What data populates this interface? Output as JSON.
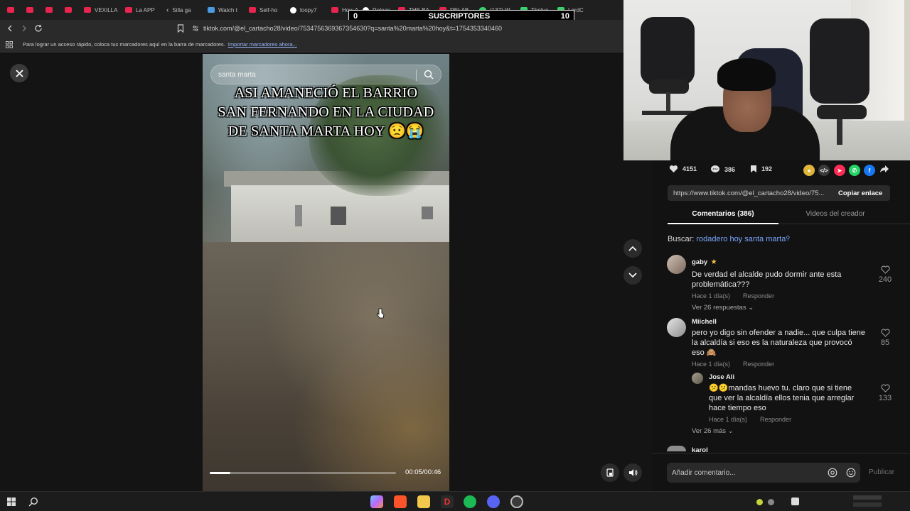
{
  "browser": {
    "tabs": [
      {
        "label": ""
      },
      {
        "label": ""
      },
      {
        "label": ""
      },
      {
        "label": ""
      },
      {
        "label": "VEXILLA"
      },
      {
        "label": "La APP"
      },
      {
        "label": "Silla ga"
      },
      {
        "label": "Watch t"
      },
      {
        "label": "Self-ho"
      },
      {
        "label": "loopy7"
      },
      {
        "label": "How A"
      },
      {
        "label": "Releas"
      },
      {
        "label": "THE BA"
      },
      {
        "label": "RELAB"
      },
      {
        "label": "(137) W"
      },
      {
        "label": "TheIva"
      },
      {
        "label": "LordC"
      }
    ],
    "url": "tiktok.com/@el_cartacho28/video/7534756369367354630?q=santa%20marta%20hoy&t=1754353340460",
    "bookmarks_hint": "Para lograr un acceso rápido, coloca tus marcadores aquí en la barra de marcadores.",
    "bookmarks_link": "Importar marcadores ahora..."
  },
  "overlay": {
    "left_count": "0",
    "title": "SUSCRIPTORES",
    "right_count": "10"
  },
  "video": {
    "search_text": "santa marta",
    "caption_lines": [
      "ASI AMANECIÓ EL BARRIO",
      "SAN FERNANDO EN LA CIUDAD",
      "DE SANTA MARTA HOY 😟😭"
    ],
    "time": "00:05/00:46",
    "progress": 0.11
  },
  "stats": {
    "likes": "4151",
    "comments": "386",
    "saves": "192"
  },
  "share": {
    "link": "https://www.tiktok.com/@el_cartacho28/video/75...",
    "copy_label": "Copiar enlace"
  },
  "tabs": {
    "comments": "Comentarios (386)",
    "creator_videos": "Videos del creador"
  },
  "search_suggest": {
    "prefix": "Buscar:",
    "query": "rodadero hoy santa marta"
  },
  "comments": [
    {
      "name": "gaby",
      "badge": "★",
      "text": "De verdad el alcalde pudo dormir ante esta problemática???",
      "time": "Hace 1 día(s)",
      "reply": "Responder",
      "likes": "240",
      "more": "Ver 26 respuestas"
    },
    {
      "name": "Miichell",
      "text": "pero yo digo sin ofender a nadie... que culpa tiene la alcaldía si eso es la naturaleza que provocó eso 🙈",
      "time": "Hace 1 día(s)",
      "reply": "Responder",
      "likes": "85"
    },
    {
      "name": "Jose Ali",
      "text": "😕😕mandas huevo tu. claro que si tiene que ver la alcaldía ellos tenia que arreglar hace tiempo eso",
      "time": "Hace 1 día(s)",
      "reply": "Responder",
      "likes": "133",
      "more": "Ver 26 más"
    },
    {
      "name": "karol"
    }
  ],
  "composer": {
    "placeholder": "Añadir comentario...",
    "publish": "Publicar"
  },
  "colors": {
    "accent_link": "#7aa7ff",
    "tiktok_red": "#fe2c55"
  }
}
